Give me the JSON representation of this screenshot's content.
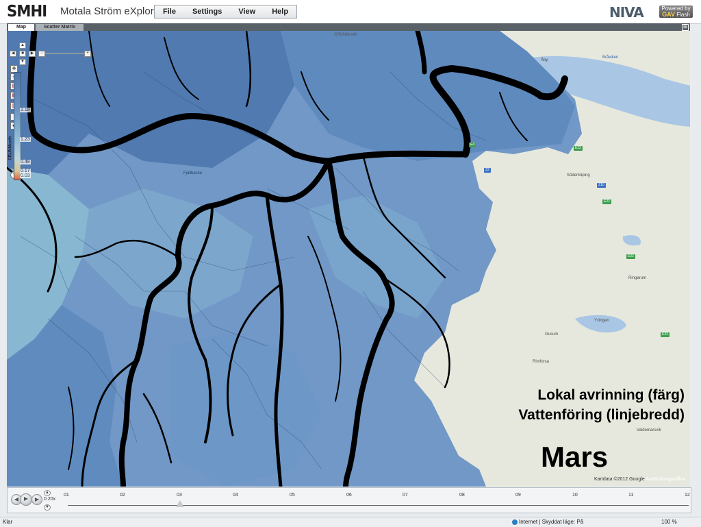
{
  "header": {
    "logo": "SMHI",
    "title": "Motala Ström eXplorer",
    "menu": [
      "File",
      "Settings",
      "View",
      "Help"
    ],
    "partner_logo": "NIVA",
    "badge_top": "Powered by",
    "badge_main": "GAV",
    "badge_sub": "Flash"
  },
  "tabs": {
    "map": "Map",
    "scatter": "Scatter Matrix",
    "layout_icon": "grid-icon"
  },
  "map": {
    "top_label": "CRUNMonth",
    "legend": {
      "title": "CRUNMonth",
      "values": [
        "2.18",
        "1.23",
        "0.48",
        "0.17",
        "0.03"
      ]
    },
    "overlay_line1": "Lokal avrinning (färg)",
    "overlay_line2": "Vattenföring (linjebredd)",
    "month": "Mars",
    "place_labels": [
      "Åby",
      "Bråviken",
      "Söderköping",
      "Fjällbacka",
      "Rimforsa",
      "Yxingen",
      "Gusum",
      "Ringarum",
      "Valdemarsvik"
    ],
    "roads": [
      "E4",
      "E22",
      "Z10",
      "Z2",
      "E22",
      "E22",
      "E22"
    ],
    "attribution": "Kartdata ©2012 Google",
    "terms": "Användningsvillkor",
    "colors": {
      "catchment_dark": "#4c77ad",
      "catchment_mid": "#6a94c4",
      "catchment_light": "#89b7d0",
      "land": "#e6e8dd",
      "water": "#a9c6e4",
      "river": "#000000"
    }
  },
  "timeline": {
    "speed": "0.20x",
    "ticks": [
      "01",
      "02",
      "03",
      "04",
      "05",
      "06",
      "07",
      "08",
      "09",
      "10",
      "11",
      "12"
    ],
    "current": "03"
  },
  "status": {
    "left": "Klar",
    "zone": "Internet | Skyddat läge: På",
    "zoom": "100 %"
  }
}
